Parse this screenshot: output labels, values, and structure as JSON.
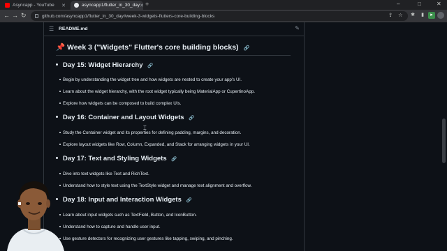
{
  "browser": {
    "tabs": [
      {
        "label": "Asyncapp - YouTube",
        "active": false,
        "icon": "youtube-icon"
      },
      {
        "label": "asyncapp1/flutter_in_30_day",
        "active": true,
        "icon": "github-icon"
      }
    ],
    "url": "github.com/asyncapp1/flutter_in_30_day#week-3-widgets-flutters-core-building-blocks"
  },
  "readme": {
    "filename": "README.md",
    "week_heading": "Week 3 (\"Widgets\" Flutter's core building blocks)",
    "days": [
      {
        "title": "Day 15: Widget Hierarchy",
        "items": [
          "Begin by understanding the widget tree and how widgets are nested to create your app's UI.",
          "Learn about the widget hierarchy, with the root widget typically being MaterialApp or CupertinoApp.",
          "Explore how widgets can be composed to build complex UIs."
        ]
      },
      {
        "title": "Day 16: Container and Layout Widgets",
        "items": [
          "Study the Container widget and its properties for defining padding, margins, and decoration.",
          "Explore layout widgets like Row, Column, Expanded, and Stack for arranging widgets in your UI."
        ]
      },
      {
        "title": "Day 17: Text and Styling Widgets",
        "items": [
          "Dive into text widgets like Text and RichText.",
          "Understand how to style text using the TextStyle widget and manage text alignment and overflow."
        ]
      },
      {
        "title": "Day 18: Input and Interaction Widgets",
        "items": [
          "Learn about input widgets such as TextField, Button, and IconButton.",
          "Understand how to capture and handle user input.",
          "Use gesture detectors for recognizing user gestures like tapping, swiping, and pinching."
        ]
      }
    ]
  }
}
